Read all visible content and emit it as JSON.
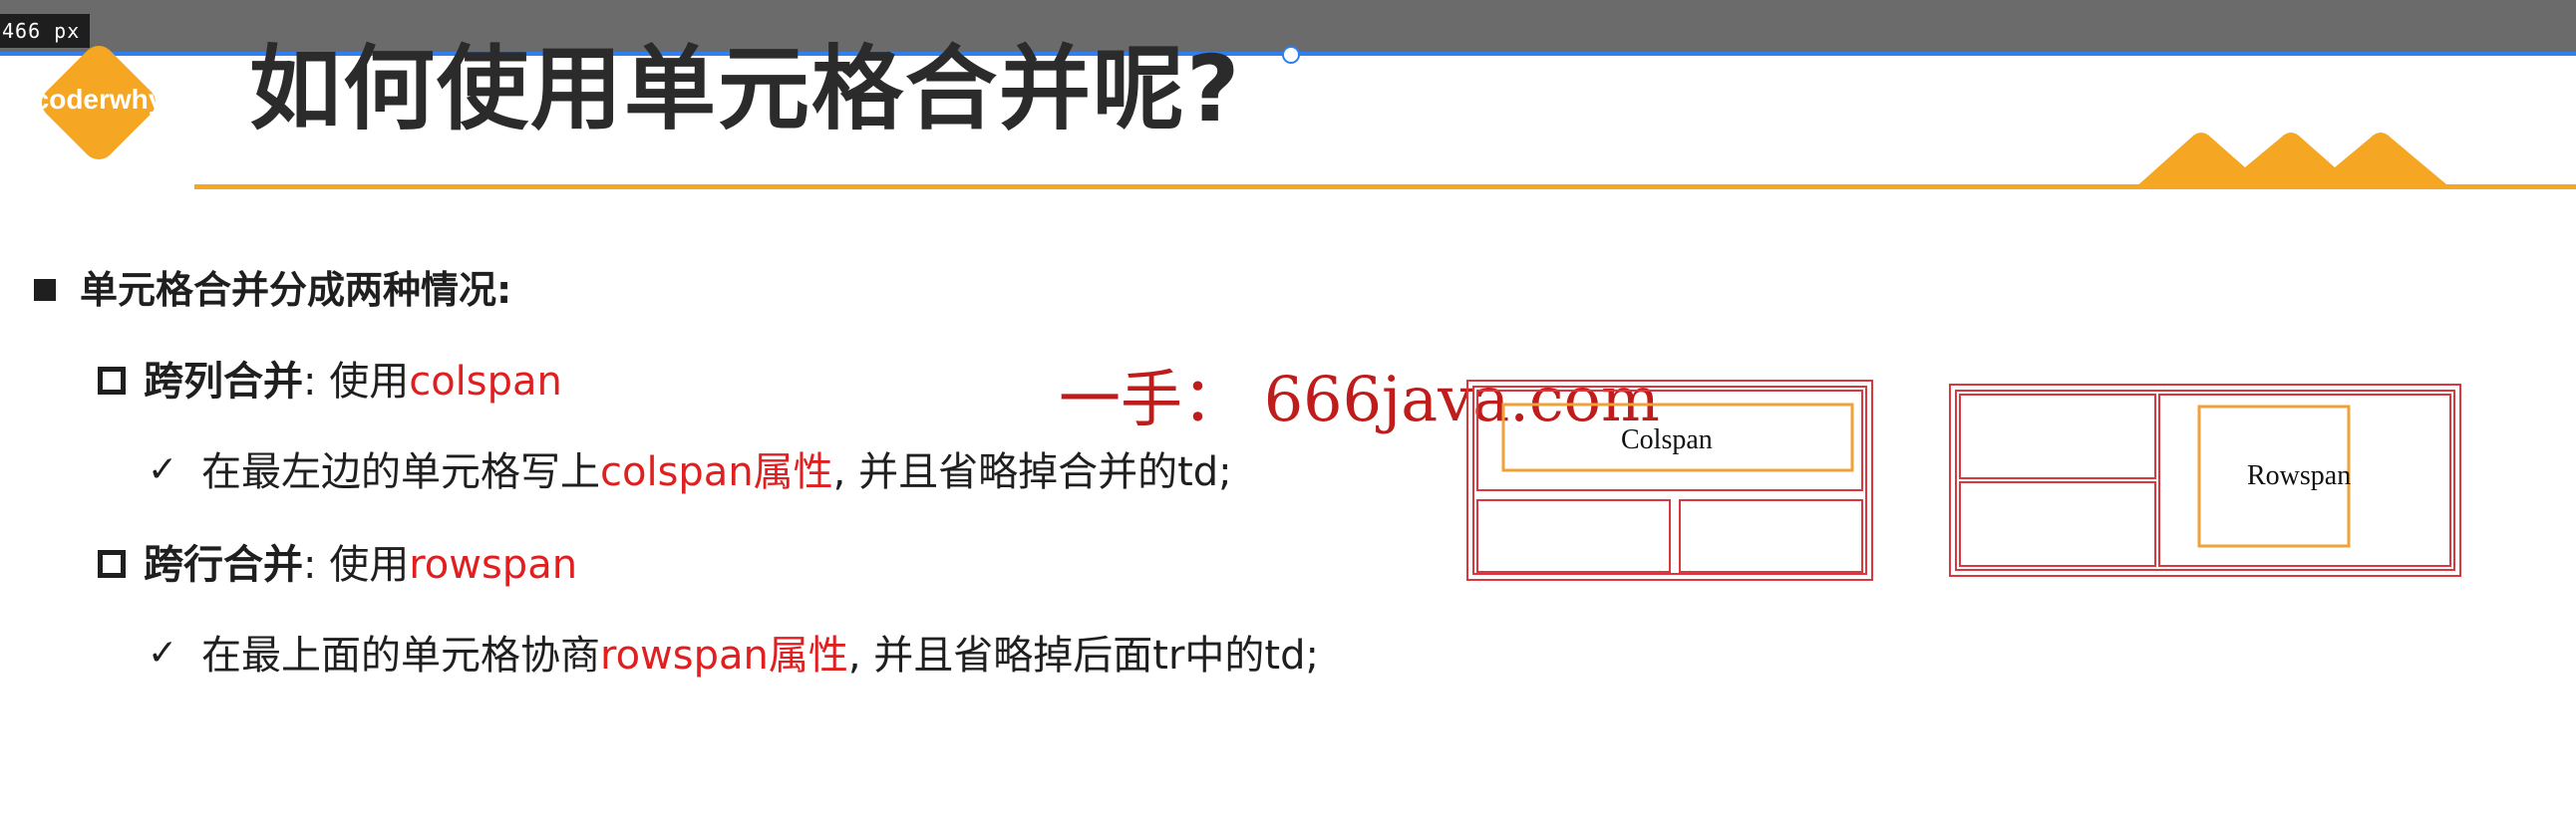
{
  "overlay": {
    "width_badge": "466 px"
  },
  "logo": {
    "text": "coderwhy"
  },
  "slide": {
    "title": "如何使用单元格合并呢?",
    "bullet": "单元格合并分成两种情况:",
    "colspan": {
      "label": "跨列合并",
      "sep": ": 使用",
      "keyword": "colspan",
      "check_icon": "✓",
      "detail_pre": "在最左边的单元格写上",
      "detail_keyword": "colspan属性",
      "detail_post": ", 并且省略掉合并的td;"
    },
    "rowspan": {
      "label": "跨行合并",
      "sep": ": 使用",
      "keyword": "rowspan",
      "check_icon": "✓",
      "detail_pre": "在最上面的单元格协商",
      "detail_keyword": "rowspan属性",
      "detail_post": ", 并且省略掉后面tr中的td;"
    }
  },
  "watermark": "一手： 666java.com",
  "diagrams": {
    "colspan_label": "Colspan",
    "rowspan_label": "Rowspan"
  },
  "colors": {
    "accent": "#f5a623",
    "keyword": "#e02020",
    "table_border": "#d9393e",
    "topbar": "#6b6b6b",
    "selection": "#2f7ff0"
  }
}
